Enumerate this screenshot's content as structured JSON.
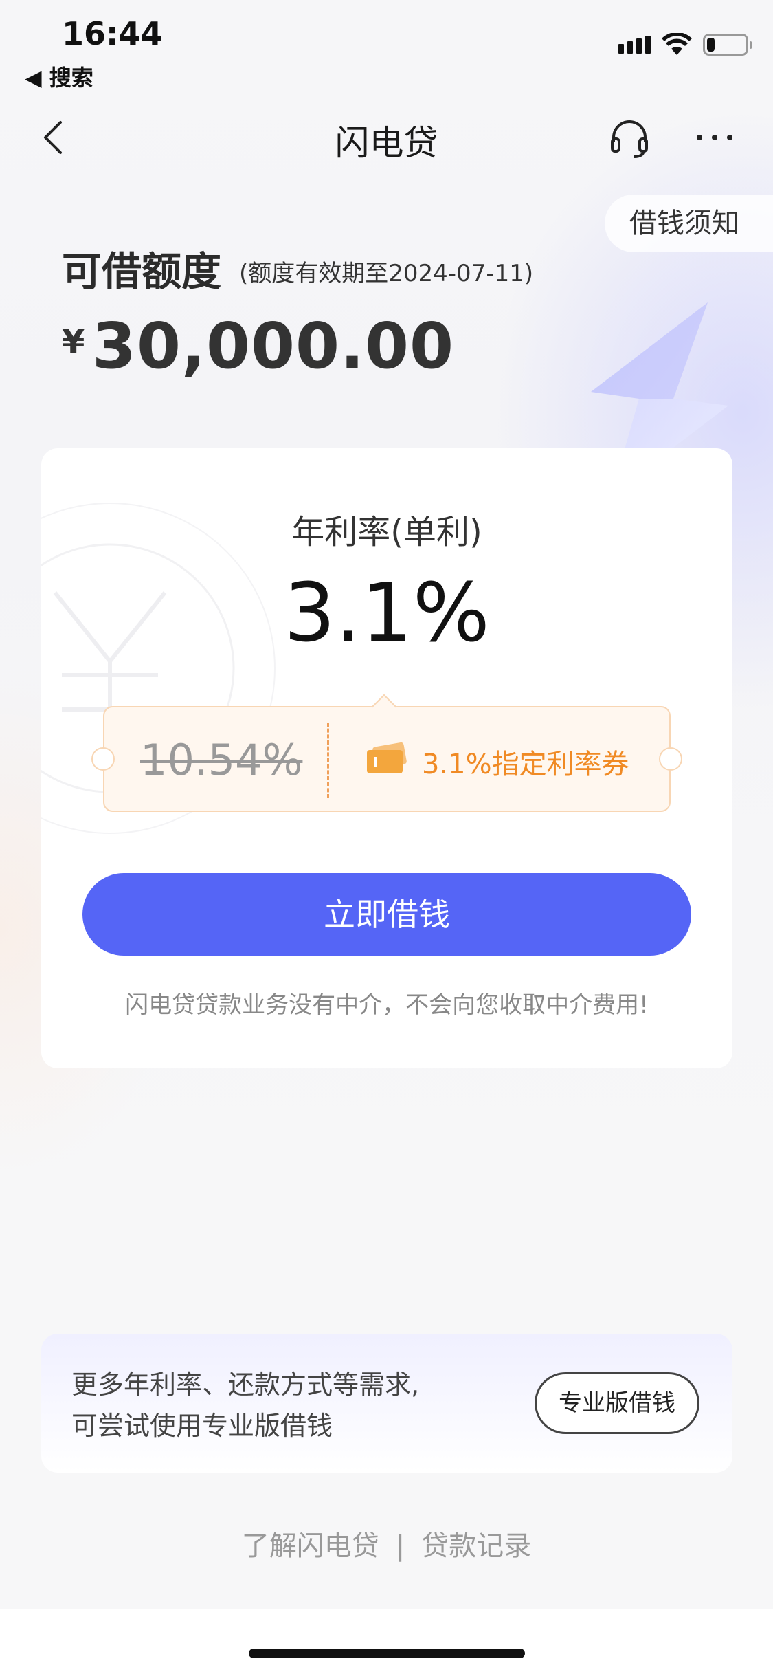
{
  "status_bar": {
    "time": "16:44",
    "back_app": "◀ 搜索",
    "battery_level": 0.2
  },
  "nav": {
    "title": "闪电贷",
    "back_icon": "chevron-left-icon",
    "service_icon": "headset-icon",
    "more_icon": "more-dots-icon"
  },
  "notice": {
    "label": "借钱须知"
  },
  "limit": {
    "label": "可借额度",
    "expiry": "(额度有效期至2024-07-11)",
    "currency": "¥",
    "amount": "30,000.00"
  },
  "rate_card": {
    "label": "年利率(单利)",
    "value": "3.1%",
    "coupon": {
      "original_rate": "10.54%",
      "coupon_text": "3.1%指定利率券",
      "icon": "ticket-icon"
    },
    "borrow_button": "立即借钱",
    "disclaimer": "闪电贷贷款业务没有中介，不会向您收取中介费用!"
  },
  "pro": {
    "line1": "更多年利率、还款方式等需求,",
    "line2": "可尝试使用专业版借钱",
    "button": "专业版借钱"
  },
  "footer": {
    "link1": "了解闪电贷",
    "separator": "|",
    "link2": "贷款记录"
  },
  "colors": {
    "primary": "#5565f6",
    "coupon_accent": "#f08a24"
  }
}
